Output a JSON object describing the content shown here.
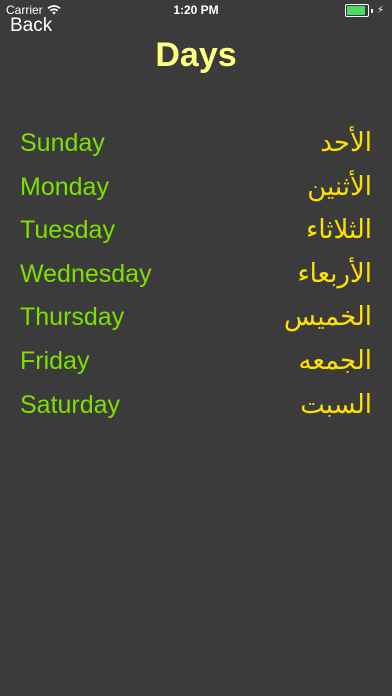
{
  "status_bar": {
    "carrier": "Carrier",
    "time": "1:20 PM",
    "battery_level": 0.9,
    "battery_color": "#4cd964"
  },
  "nav": {
    "back_label": "Back"
  },
  "title": "Days",
  "days": [
    {
      "english": "Sunday",
      "arabic": "الأحد"
    },
    {
      "english": "Monday",
      "arabic": "الأثنين"
    },
    {
      "english": "Tuesday",
      "arabic": "الثلاثاء"
    },
    {
      "english": "Wednesday",
      "arabic": "الأربعاء"
    },
    {
      "english": "Thursday",
      "arabic": "الخميس"
    },
    {
      "english": "Friday",
      "arabic": "الجمعه"
    },
    {
      "english": "Saturday",
      "arabic": "السبت"
    }
  ],
  "colors": {
    "background": "#3b3b3b",
    "title": "#ffff80",
    "english_text": "#7ee000",
    "arabic_text": "#ffe100"
  },
  "icons": {
    "signal": "wifi-icon",
    "battery": "battery-icon",
    "charging": "bolt-icon"
  }
}
